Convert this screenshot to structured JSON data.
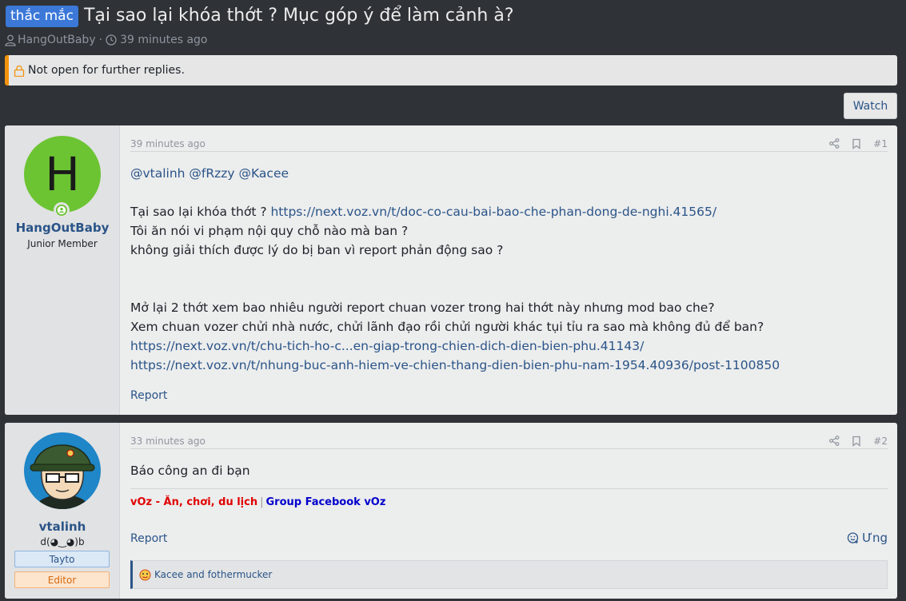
{
  "thread": {
    "prefix": "thắc mắc",
    "title": "Tại sao lại khóa thớt ? Mục góp ý để làm cảnh à?",
    "author": "HangOutBaby",
    "time": "39 minutes ago",
    "notice": "Not open for further replies.",
    "watch_label": "Watch"
  },
  "posts": [
    {
      "time": "39 minutes ago",
      "number": "#1",
      "avatar_letter": "H",
      "avatar_color": "#6cc433",
      "username": "HangOutBaby",
      "user_title": "Junior Member",
      "mentions": "@vtalinh @fRzzy @Kacee",
      "line1_text": "Tại sao lại khóa thớt ? ",
      "line1_link": "https://next.voz.vn/t/doc-co-cau-bai-bao-che-phan-dong-de-nghi.41565/",
      "line2": "Tôi ăn nói vi phạm nội quy chỗ nào mà ban ?",
      "line3": "không giải thích được lý do bị ban vì report phản động sao ?",
      "line4": "Mở lại 2 thớt xem bao nhiêu người report chuan vozer trong hai thớt này nhưng mod bao che?",
      "line5": "Xem chuan vozer chửi nhà nước, chửi lãnh đạo rồi chửi người khác tụi tỉu ra sao mà không đủ để ban?",
      "link2": "https://next.voz.vn/t/chu-tich-ho-c...en-giap-trong-chien-dich-dien-bien-phu.41143/",
      "link3": "https://next.voz.vn/t/nhung-buc-anh-hiem-ve-chien-thang-dien-bien-phu-nam-1954.40936/post-1100850",
      "report_label": "Report"
    },
    {
      "time": "33 minutes ago",
      "number": "#2",
      "username": "vtalinh",
      "user_title": "d(◕‿◕)b",
      "banner1": "Tayto",
      "banner2": "Editor",
      "body": "Báo công an đi bạn",
      "sig_part1": "vOz - Ăn, chơi, du lịch",
      "sig_sep": "|",
      "sig_part2": "Group Facebook vOz",
      "report_label": "Report",
      "react_label": "Ưng",
      "reactions": "Kacee and fothermucker"
    }
  ],
  "icons": {
    "user": "user-icon",
    "clock": "clock-icon",
    "lock": "lock-icon",
    "share": "share-icon",
    "bookmark": "bookmark-icon",
    "react": "react-icon"
  }
}
